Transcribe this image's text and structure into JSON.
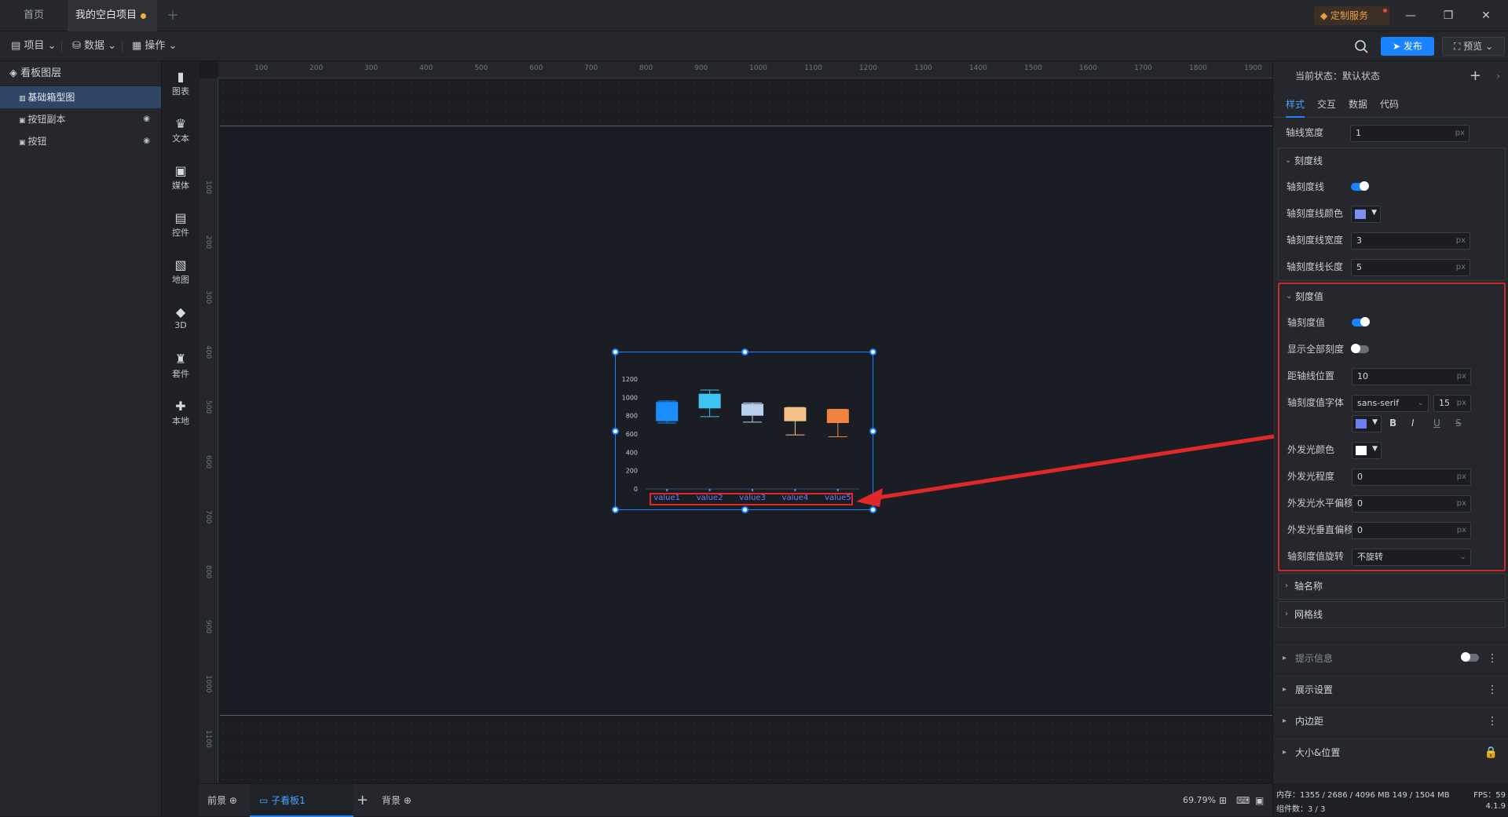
{
  "tabs": {
    "home": "首页",
    "project": "我的空白项目"
  },
  "custom_service": "定制服务",
  "toolbar": {
    "project": "项目",
    "data": "数据",
    "operate": "操作",
    "publish": "发布",
    "preview": "预览"
  },
  "layers": {
    "title": "看板图层",
    "items": [
      {
        "label": "基础箱型图",
        "active": true
      },
      {
        "label": "按钮副本"
      },
      {
        "label": "按钮"
      }
    ]
  },
  "components": [
    "图表",
    "文本",
    "媒体",
    "控件",
    "地图",
    "3D",
    "套件",
    "本地"
  ],
  "ruler": {
    "h": [
      "100",
      "200",
      "300",
      "400",
      "500",
      "600",
      "700",
      "800",
      "900",
      "1000",
      "1100",
      "1200",
      "1300",
      "1400",
      "1500",
      "1600",
      "1700",
      "1800",
      "1900"
    ],
    "v": [
      "100",
      "200",
      "300",
      "400",
      "500",
      "600",
      "700",
      "800",
      "900",
      "1000",
      "1100"
    ]
  },
  "chart_data": {
    "type": "boxplot",
    "categories": [
      "value1",
      "value2",
      "value3",
      "value4",
      "value5"
    ],
    "yticks": [
      0,
      200,
      400,
      600,
      800,
      1000,
      1200
    ],
    "ylim": [
      0,
      1200
    ],
    "colors": [
      "#1a8dff",
      "#3fc3f0",
      "#b9cfee",
      "#f5c28a",
      "#f0843e"
    ],
    "series": [
      {
        "min": 720,
        "q1": 740,
        "q3": 950,
        "max": 960
      },
      {
        "min": 790,
        "q1": 880,
        "q3": 1040,
        "max": 1080
      },
      {
        "min": 730,
        "q1": 800,
        "q3": 930,
        "max": 940
      },
      {
        "min": 590,
        "q1": 740,
        "q3": 890,
        "max": 890
      },
      {
        "min": 570,
        "q1": 720,
        "q3": 870,
        "max": 870
      }
    ]
  },
  "bottombar": {
    "front": "前景",
    "sub": "子看板1",
    "bg": "背景",
    "zoom": "69.79%"
  },
  "panel": {
    "state": "当前状态：默认状态",
    "tabs": [
      "样式",
      "交互",
      "数据",
      "代码"
    ],
    "axis_width": {
      "label": "轴线宽度",
      "value": "1",
      "unit": "px"
    },
    "tick_line": {
      "title": "刻度线",
      "show": "轴刻度线",
      "color": "轴刻度线颜色",
      "color_value": "#7b8ff5",
      "width": {
        "label": "轴刻度线宽度",
        "value": "3",
        "unit": "px"
      },
      "length": {
        "label": "轴刻度线长度",
        "value": "5",
        "unit": "px"
      }
    },
    "tick_value": {
      "title": "刻度值",
      "show": "轴刻度值",
      "show_all": "显示全部刻度",
      "distance": {
        "label": "距轴线位置",
        "value": "10",
        "unit": "px"
      },
      "font": {
        "label": "轴刻度值字体",
        "family": "sans-serif",
        "size": "15",
        "unit": "px"
      },
      "font_color": "#6b7ef2",
      "glow_color": {
        "label": "外发光颜色",
        "value": "#ffffff"
      },
      "glow_level": {
        "label": "外发光程度",
        "value": "0",
        "unit": "px"
      },
      "glow_x": {
        "label": "外发光水平偏移",
        "value": "0",
        "unit": "px"
      },
      "glow_y": {
        "label": "外发光垂直偏移",
        "value": "0",
        "unit": "px"
      },
      "rotate": {
        "label": "轴刻度值旋转",
        "value": "不旋转"
      }
    },
    "axis_name": "轴名称",
    "grid_line": "网格线",
    "sections": [
      "提示信息",
      "展示设置",
      "内边距",
      "大小&位置"
    ]
  },
  "status": {
    "memory": "内存：1355 / 2686 / 4096 MB  149 / 1504 MB",
    "fps": "FPS：59",
    "count": "组件数：3 / 3",
    "version": "4.1.9"
  }
}
